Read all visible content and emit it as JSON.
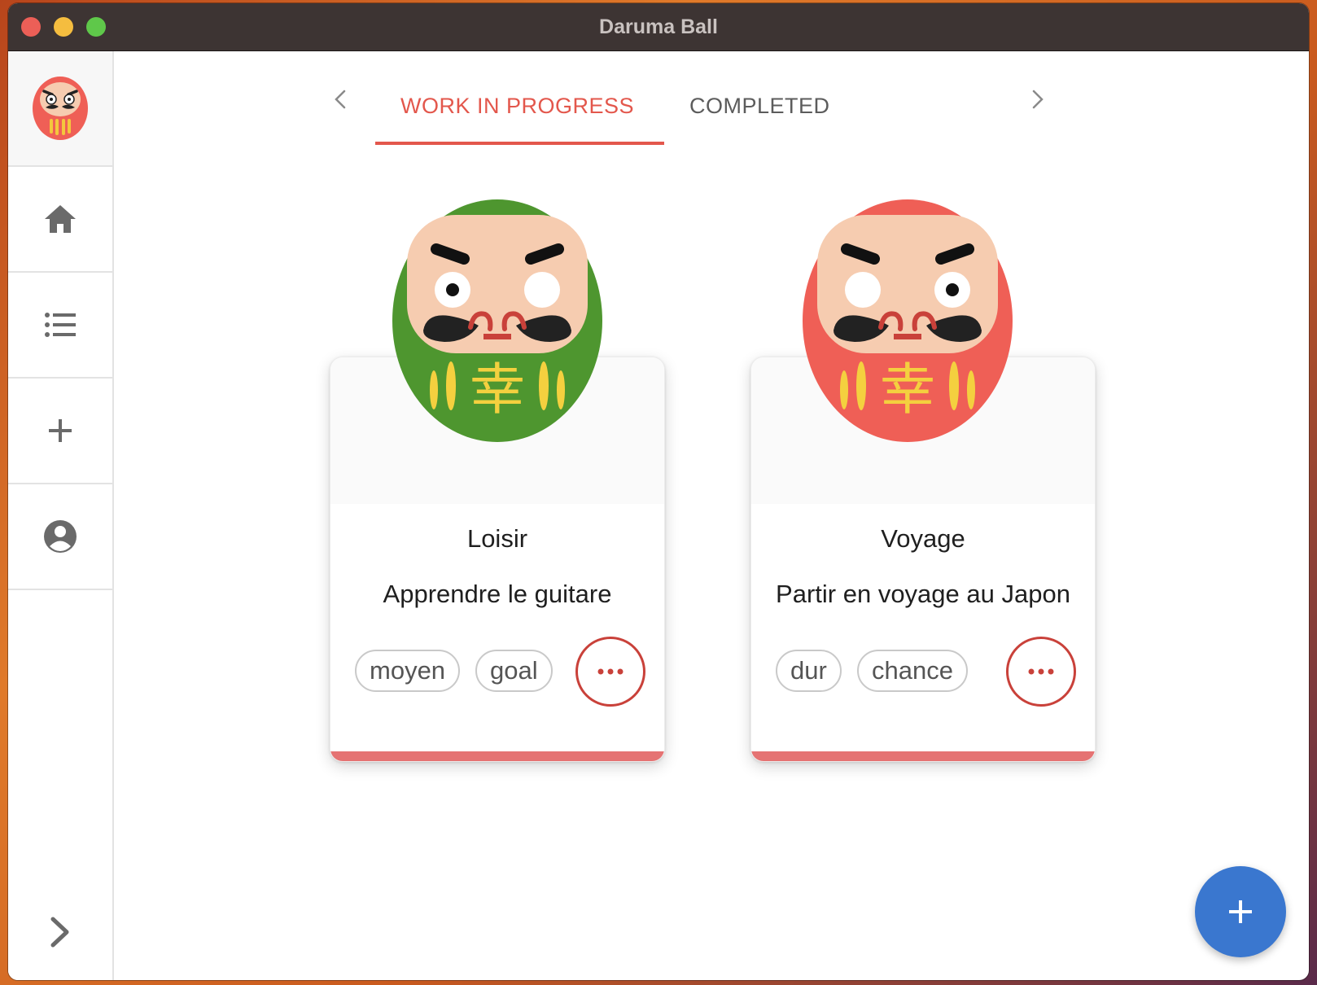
{
  "window": {
    "title": "Daruma Ball"
  },
  "sidebar": {
    "items": [
      {
        "name": "home",
        "icon": "home-icon"
      },
      {
        "name": "list",
        "icon": "list-icon"
      },
      {
        "name": "add",
        "icon": "plus-icon"
      },
      {
        "name": "profile",
        "icon": "account-circle-icon"
      }
    ],
    "expand_icon": "chevron-right-icon"
  },
  "tabs": [
    {
      "label": "WORK IN PROGRESS",
      "active": true
    },
    {
      "label": "COMPLETED",
      "active": false
    }
  ],
  "cards": [
    {
      "category": "Loisir",
      "goal": "Apprendre le guitare",
      "tags": [
        "moyen",
        "goal"
      ],
      "daruma_color": "#4e962f",
      "glyph": "幸"
    },
    {
      "category": "Voyage",
      "goal": "Partir en voyage au Japon",
      "tags": [
        "dur",
        "chance"
      ],
      "daruma_color": "#ef5f56",
      "glyph": "幸"
    }
  ],
  "colors": {
    "accent": "#e3574c",
    "fab": "#3a77cf",
    "card_bar": "#e57373"
  }
}
